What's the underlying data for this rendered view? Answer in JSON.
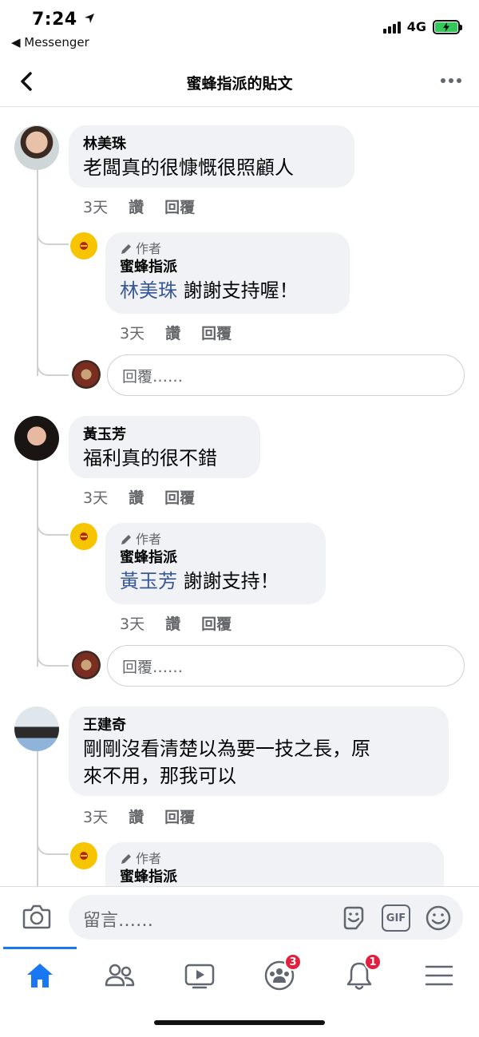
{
  "status": {
    "time": "7:24",
    "back_app": "◀ Messenger",
    "network": "4G"
  },
  "header": {
    "title": "蜜蜂指派的貼文"
  },
  "comments": [
    {
      "author": "林美珠",
      "text": "老闆真的很慷慨很照顧人",
      "age": "3天",
      "like": "讚",
      "reply": "回覆",
      "reply_item": {
        "role": "作者",
        "author": "蜜蜂指派",
        "mention": "林美珠",
        "text": " 謝謝支持喔！",
        "age": "3天",
        "like": "讚",
        "reply": "回覆"
      },
      "reply_placeholder": "回覆……"
    },
    {
      "author": "黃玉芳",
      "text": "福利真的很不錯",
      "age": "3天",
      "like": "讚",
      "reply": "回覆",
      "reply_item": {
        "role": "作者",
        "author": "蜜蜂指派",
        "mention": "黃玉芳",
        "text": " 謝謝支持！",
        "age": "3天",
        "like": "讚",
        "reply": "回覆"
      },
      "reply_placeholder": "回覆……"
    },
    {
      "author": "王建奇",
      "text_line1": "剛剛沒看清楚以為要一技之長，原",
      "text_line2": "來不用，那我可以",
      "age": "3天",
      "like": "讚",
      "reply": "回覆",
      "reply_item": {
        "role": "作者",
        "author": "蜜蜂指派"
      }
    }
  ],
  "composer": {
    "placeholder": "留言……",
    "gif_label": "GIF"
  },
  "tabs": {
    "groups_badge": "3",
    "notifications_badge": "1"
  },
  "colors": {
    "accent": "#1877f2",
    "mention": "#385898",
    "badge": "#e41e3f",
    "bubble": "#f0f2f5"
  }
}
